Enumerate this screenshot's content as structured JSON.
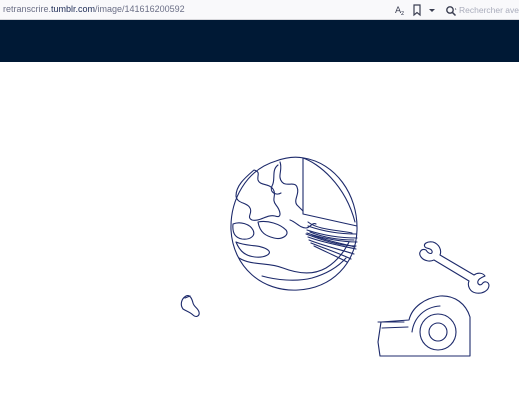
{
  "browser": {
    "url_prefix": "retranscrire.",
    "url_host": "tumblr.com",
    "url_path": "/image/141616200592",
    "search_placeholder": "Rechercher avec"
  },
  "icons": [
    "translate-icon",
    "bookmark-icon",
    "chevron-down-icon",
    "search-icon"
  ],
  "colors": {
    "navbar": "#001935",
    "ink": "#1d2a6b"
  },
  "image": {
    "subjects": [
      "globe-drawing",
      "wrench-drawing",
      "tape-dispenser-drawing",
      "small-piece-drawing"
    ]
  }
}
